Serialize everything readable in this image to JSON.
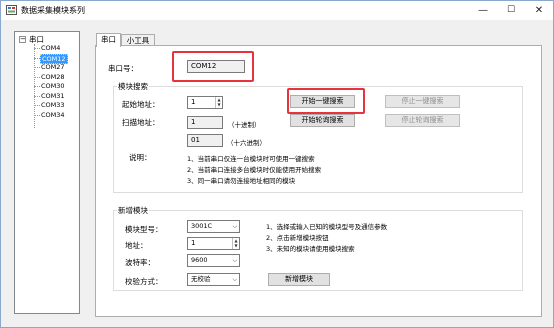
{
  "window": {
    "title": "数据采集模块系列",
    "min_glyph": "—",
    "max_glyph": "☐",
    "close_glyph": "✕"
  },
  "tree": {
    "root": "串口",
    "toggle": "−",
    "items": [
      "COM4",
      "COM12",
      "COM27",
      "COM28",
      "COM30",
      "COM31",
      "COM33",
      "COM34"
    ],
    "selected_index": 1
  },
  "tabs": [
    {
      "label": "串口",
      "active": true
    },
    {
      "label": "小工具",
      "active": false
    }
  ],
  "serial": {
    "port_label": "串口号：",
    "port_value": "COM12"
  },
  "search": {
    "group_title": "模块搜索",
    "start_addr_label": "起始地址：",
    "start_addr_value": "1",
    "scan_addr_label": "扫描地址：",
    "scan_dec_value": "1",
    "dec_note": "（十进制）",
    "scan_hex_value": "01",
    "hex_note": "（十六进制）",
    "btn_one_key": "开始一键搜索",
    "btn_stop_one_key": "停止一键搜索",
    "btn_poll": "开始轮询搜索",
    "btn_stop_poll": "停止轮询搜索",
    "desc_label": "说明：",
    "desc_lines": [
      "1、当前串口仅连一台模块时可使用一键搜索",
      "2、当前串口连接多台模块时仅能使用开始搜索",
      "3、同一串口请勿连接地址相同的模块"
    ]
  },
  "add": {
    "group_title": "新增模块",
    "model_label": "模块型号：",
    "model_value": "3001C",
    "addr_label": "地址：",
    "addr_value": "1",
    "baud_label": "波特率：",
    "baud_value": "9600",
    "check_label": "校验方式：",
    "check_value": "无校验",
    "btn_add": "新增模块",
    "notes": [
      "1、选择或输入已知的模块型号及通信参数",
      "2、点击新增模块按钮",
      "3、未知的模块请使用模块搜索"
    ]
  },
  "colors": {
    "highlight": "#e8333f",
    "selection": "#3399ff",
    "window_bg": "#f0f0f0"
  }
}
